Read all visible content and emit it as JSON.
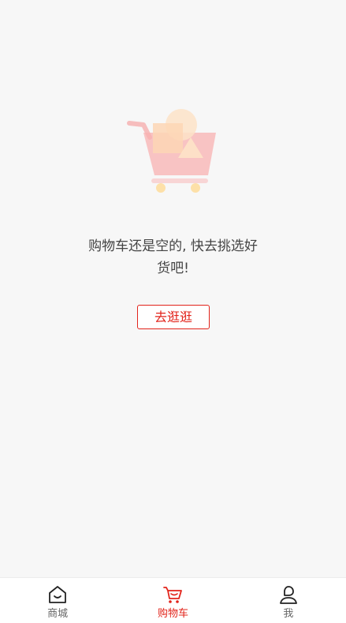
{
  "empty_state": {
    "illustration_icon": "cart-empty-illustration-icon",
    "message_line1": "购物车还是空的, 快去挑选好",
    "message_line2": "货吧!",
    "action_label": "去逛逛"
  },
  "tab_bar": {
    "tabs": [
      {
        "label": "商城",
        "icon": "home-icon",
        "active": false
      },
      {
        "label": "购物车",
        "icon": "cart-icon",
        "active": true
      },
      {
        "label": "我",
        "icon": "user-icon",
        "active": false
      }
    ]
  },
  "colors": {
    "accent": "#e2231a",
    "background": "#f7f7f7",
    "text": "#444444",
    "tab_inactive": "#666666"
  }
}
